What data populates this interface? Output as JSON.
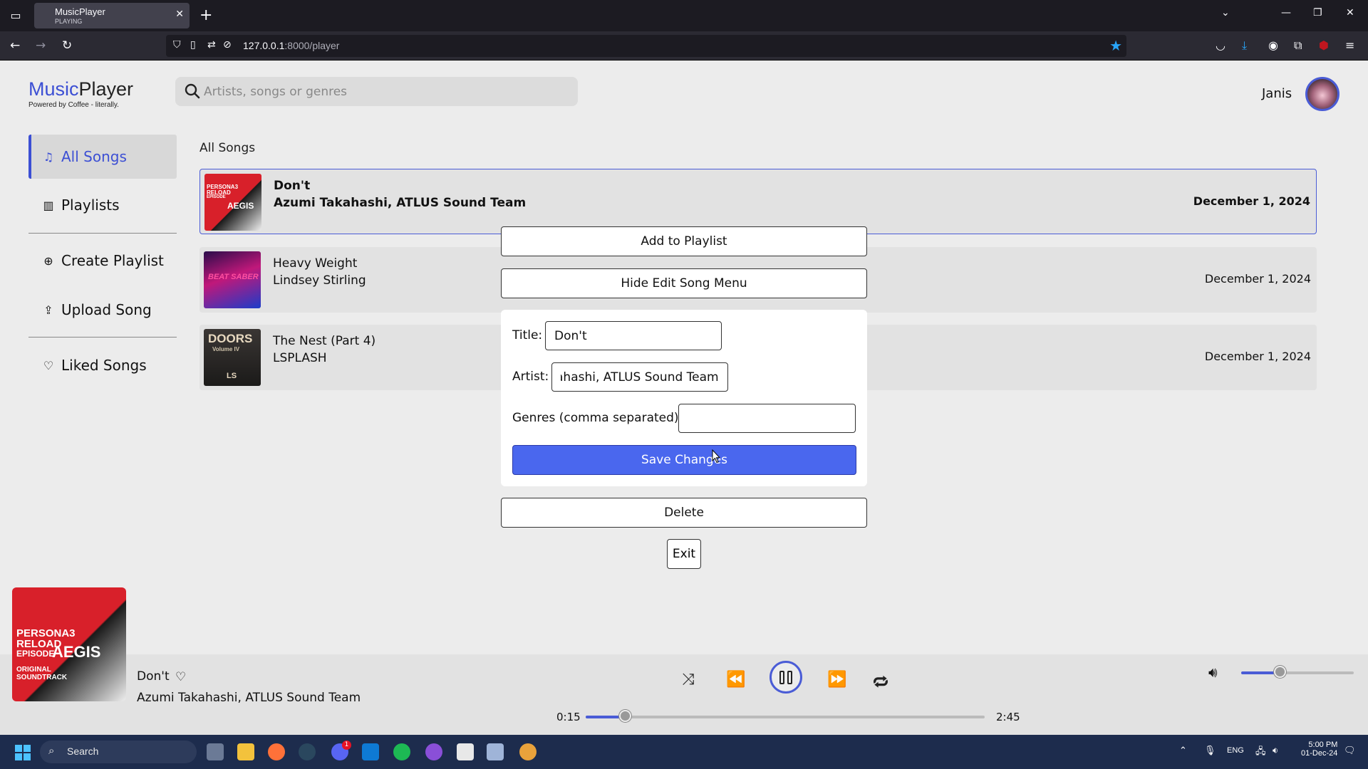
{
  "browser": {
    "tab_title": "MusicPlayer",
    "tab_subtitle": "PLAYING",
    "url_host": "127.0.0.1",
    "url_path": ":8000/player"
  },
  "app": {
    "logo_music": "Music",
    "logo_player": "Player",
    "tagline": "Powered by Coffee - literally.",
    "search_placeholder": "Artists, songs or genres",
    "user_name": "Janis"
  },
  "sidebar": {
    "items": [
      {
        "label": "All Songs",
        "icon": "music-note-icon",
        "active": true
      },
      {
        "label": "Playlists",
        "icon": "library-icon"
      },
      {
        "label": "Create Playlist",
        "icon": "plus-circle-icon"
      },
      {
        "label": "Upload Song",
        "icon": "upload-icon"
      },
      {
        "label": "Liked Songs",
        "icon": "heart-icon"
      }
    ]
  },
  "songs": {
    "heading": "All Songs",
    "rows": [
      {
        "title": "Don't",
        "artist": "Azumi Takahashi, ATLUS Sound Team",
        "date": "December 1, 2024",
        "selected": true
      },
      {
        "title": "Heavy Weight",
        "artist": "Lindsey Stirling",
        "date": "December 1, 2024"
      },
      {
        "title": "The Nest (Part 4)",
        "artist": "LSPLASH",
        "date": "December 1, 2024"
      }
    ]
  },
  "art_text": {
    "persona_line1": "PERSONA3",
    "persona_line2": "RELOAD",
    "persona_line3": "EPISODE",
    "persona_line4": "AEGIS",
    "persona_line5": "ORIGINAL",
    "persona_line6": "SOUNDTRACK",
    "beat": "BEAT SABER",
    "doors_title": "DOORS",
    "doors_sub": "Volume IV",
    "doors_ls": "LS"
  },
  "dialog": {
    "add_to_playlist": "Add to Playlist",
    "hide_edit_menu": "Hide Edit Song Menu",
    "title_label": "Title:",
    "title_value": "Don't",
    "artist_label": "Artist:",
    "artist_value": "ahashi, ATLUS Sound Team",
    "genres_label": "Genres (comma separated):",
    "genres_value": "",
    "save_changes": "Save Changes",
    "delete": "Delete",
    "exit": "Exit"
  },
  "player": {
    "title": "Don't",
    "artist": "Azumi Takahashi, ATLUS Sound Team",
    "elapsed": "0:15",
    "duration": "2:45",
    "progress": 0.1,
    "volume": 0.35,
    "state": "playing"
  },
  "taskbar": {
    "search_label": "Search",
    "discord_badge": "1",
    "language": "ENG",
    "time": "5:00 PM",
    "date": "01-Dec-24"
  },
  "colors": {
    "accent": "#3c4fd4",
    "save_button": "#4a67ee",
    "taskbar": "#1d2c4d"
  }
}
